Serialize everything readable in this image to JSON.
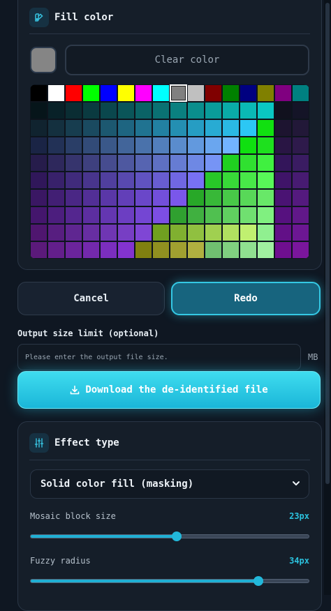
{
  "fill_color": {
    "title": "Fill color",
    "icon": "palette-icon",
    "current_color": "#858585",
    "clear_label": "Clear color",
    "palette_rows": [
      [
        "#000000",
        "#ffffff",
        "#ff0000",
        "#00ff00",
        "#0000ff",
        "#ffff00",
        "#ff00ff",
        "#00ffff",
        "#808080",
        "#c0c0c0",
        "#800000",
        "#008000",
        "#000080",
        "#808000",
        "#800080",
        "#008080"
      ],
      [
        "#06151a",
        "#082128",
        "#0a2d33",
        "#0a3a40",
        "#0a474d",
        "#0a5559",
        "#0a6366",
        "#0a7173",
        "#0a8080",
        "#0a8e8d",
        "#0a9c9a",
        "#0aaba8",
        "#0ab9b5",
        "#0ac7c2",
        "#11111e",
        "#141427"
      ],
      [
        "#10232f",
        "#14303f",
        "#173d4f",
        "#1a4a60",
        "#1c5870",
        "#1e6581",
        "#207391",
        "#2281a2",
        "#248fb2",
        "#269dc3",
        "#28abd3",
        "#2ab9e4",
        "#2cc7f4",
        "#11e010",
        "#1d1430",
        "#221838"
      ],
      [
        "#1a2445",
        "#223156",
        "#2a3e67",
        "#324b78",
        "#3a5889",
        "#42659a",
        "#4a72ab",
        "#527fbc",
        "#5a8ccd",
        "#6299de",
        "#6aa6ef",
        "#72b3ff",
        "#10e010",
        "#1ee01e",
        "#291544",
        "#2e1a4b"
      ],
      [
        "#261c4b",
        "#2e285c",
        "#36346d",
        "#3e407e",
        "#464c8f",
        "#4e58a0",
        "#5664b1",
        "#5e70c2",
        "#667cd3",
        "#6e88e4",
        "#7694f5",
        "#20d020",
        "#30e030",
        "#40f040",
        "#33155a",
        "#3a1c62"
      ],
      [
        "#30175a",
        "#38216b",
        "#402b7c",
        "#48358d",
        "#503f9e",
        "#5849af",
        "#6053c0",
        "#685dd1",
        "#7067e2",
        "#7871f3",
        "#28c828",
        "#38d838",
        "#48e848",
        "#58f858",
        "#3f1468",
        "#471b71"
      ],
      [
        "#3a1763",
        "#421f74",
        "#4a2785",
        "#522f96",
        "#5a37a7",
        "#623fb8",
        "#6a47c9",
        "#724fda",
        "#7a57eb",
        "#28a828",
        "#38b838",
        "#48c848",
        "#58d858",
        "#68e868",
        "#4a1373",
        "#541a7e"
      ],
      [
        "#44166d",
        "#4c1e7e",
        "#54268f",
        "#5c2ea0",
        "#6436b1",
        "#6c3ec2",
        "#7446d3",
        "#7c4ee4",
        "#30a030",
        "#40b040",
        "#50c050",
        "#60d060",
        "#70e070",
        "#80f080",
        "#56117f",
        "#611889"
      ],
      [
        "#4f166f",
        "#571e80",
        "#5f2691",
        "#672ea2",
        "#6f36b3",
        "#773ec4",
        "#7f46d5",
        "#70a020",
        "#80b030",
        "#90c040",
        "#a0d050",
        "#b0e060",
        "#c0f070",
        "#90f090",
        "#621087",
        "#6c1793"
      ],
      [
        "#5b1a7a",
        "#631f8b",
        "#6b249c",
        "#7329ad",
        "#7b2ebe",
        "#8333cf",
        "#808010",
        "#909020",
        "#a0a030",
        "#b0b040",
        "#70c070",
        "#80d080",
        "#90e090",
        "#a0f0a0",
        "#6f0f8f",
        "#7a169c"
      ]
    ],
    "selected_cell": "0-8"
  },
  "actions": {
    "cancel_label": "Cancel",
    "redo_label": "Redo"
  },
  "output": {
    "label": "Output size limit (optional)",
    "placeholder": "Please enter the output file size.",
    "value": "",
    "unit": "MB"
  },
  "download": {
    "label": "Download the de-identified file",
    "icon": "download-icon"
  },
  "effect": {
    "title": "Effect type",
    "icon": "sliders-icon",
    "selected": "Solid color fill (masking)",
    "mosaic": {
      "label": "Mosaic block size",
      "value_text": "23px",
      "percent": 52.5
    },
    "fuzzy": {
      "label": "Fuzzy radius",
      "value_text": "34px",
      "percent": 82
    }
  }
}
